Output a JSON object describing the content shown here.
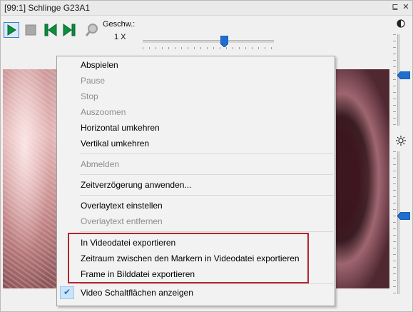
{
  "window": {
    "title": "[99:1] Schlinge G23A1",
    "pin_glyph": "⊑",
    "close_glyph": "✕"
  },
  "toolbar": {
    "buttons": [
      "play-icon",
      "stop-icon",
      "skip-previous-icon",
      "skip-next-icon",
      "zoom-icon"
    ],
    "speed_label": "Geschw.:",
    "speed_value": "1 X",
    "speed_slider_position": 0.62
  },
  "right_panel": {
    "contrast_icon": "contrast-icon",
    "brightness_icon": "brightness-icon",
    "contrast_level": 0.45,
    "brightness_level": 0.45
  },
  "context_menu": {
    "items": [
      {
        "label": "Abspielen",
        "enabled": true
      },
      {
        "label": "Pause",
        "enabled": false
      },
      {
        "label": "Stop",
        "enabled": false
      },
      {
        "label": "Auszoomen",
        "enabled": false
      },
      {
        "label": "Horizontal umkehren",
        "enabled": true
      },
      {
        "label": "Vertikal umkehren",
        "enabled": true
      },
      {
        "label": "Abmelden",
        "enabled": false
      },
      {
        "label": "Zeitverzögerung anwenden...",
        "enabled": true
      },
      {
        "label": "Overlaytext einstellen",
        "enabled": true
      },
      {
        "label": "Overlaytext entfernen",
        "enabled": false
      },
      {
        "label": "In Videodatei exportieren",
        "enabled": true
      },
      {
        "label": "Zeitraum zwischen den Markern in Videodatei exportieren",
        "enabled": true
      },
      {
        "label": "Frame in Bilddatei exportieren",
        "enabled": true
      },
      {
        "label": "Video Schaltflächen anzeigen",
        "enabled": true,
        "checked": true
      }
    ],
    "check_glyph": "✔"
  },
  "colors": {
    "accent_blue": "#1f6fd0",
    "green_control": "#0a8f3c",
    "highlight_red": "#b4252d",
    "check_blue": "#2a70c8"
  }
}
